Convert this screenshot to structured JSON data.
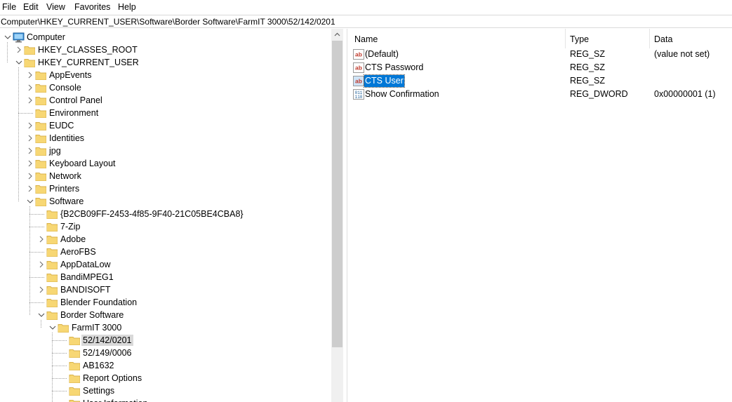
{
  "menu": [
    "File",
    "Edit",
    "View",
    "Favorites",
    "Help"
  ],
  "address": "Computer\\HKEY_CURRENT_USER\\Software\\Border Software\\FarmIT 3000\\52/142/0201",
  "colors": {
    "folder": "#f7d774",
    "folder_edge": "#d9b24a",
    "selection": "#0078d7",
    "tree_selection": "#d9d9d9"
  },
  "tree": [
    {
      "label": "Computer",
      "level": 0,
      "state": "expanded",
      "icon": "computer-icon"
    },
    {
      "label": "HKEY_CLASSES_ROOT",
      "level": 1,
      "state": "collapsed"
    },
    {
      "label": "HKEY_CURRENT_USER",
      "level": 1,
      "state": "expanded"
    },
    {
      "label": "AppEvents",
      "level": 2,
      "state": "collapsed"
    },
    {
      "label": "Console",
      "level": 2,
      "state": "collapsed"
    },
    {
      "label": "Control Panel",
      "level": 2,
      "state": "collapsed"
    },
    {
      "label": "Environment",
      "level": 2,
      "state": "leaf"
    },
    {
      "label": "EUDC",
      "level": 2,
      "state": "collapsed"
    },
    {
      "label": "Identities",
      "level": 2,
      "state": "collapsed"
    },
    {
      "label": "jpg",
      "level": 2,
      "state": "collapsed"
    },
    {
      "label": "Keyboard Layout",
      "level": 2,
      "state": "collapsed"
    },
    {
      "label": "Network",
      "level": 2,
      "state": "collapsed"
    },
    {
      "label": "Printers",
      "level": 2,
      "state": "collapsed"
    },
    {
      "label": "Software",
      "level": 2,
      "state": "expanded"
    },
    {
      "label": "{B2CB09FF-2453-4f85-9F40-21C05BE4CBA8}",
      "level": 3,
      "state": "leaf"
    },
    {
      "label": "7-Zip",
      "level": 3,
      "state": "leaf"
    },
    {
      "label": "Adobe",
      "level": 3,
      "state": "collapsed"
    },
    {
      "label": "AeroFBS",
      "level": 3,
      "state": "leaf"
    },
    {
      "label": "AppDataLow",
      "level": 3,
      "state": "collapsed"
    },
    {
      "label": "BandiMPEG1",
      "level": 3,
      "state": "leaf"
    },
    {
      "label": "BANDISOFT",
      "level": 3,
      "state": "collapsed"
    },
    {
      "label": "Blender Foundation",
      "level": 3,
      "state": "leaf"
    },
    {
      "label": "Border Software",
      "level": 3,
      "state": "expanded"
    },
    {
      "label": "FarmIT 3000",
      "level": 4,
      "state": "expanded"
    },
    {
      "label": "52/142/0201",
      "level": 5,
      "state": "leaf",
      "selected": true
    },
    {
      "label": "52/149/0006",
      "level": 5,
      "state": "leaf"
    },
    {
      "label": "AB1632",
      "level": 5,
      "state": "leaf"
    },
    {
      "label": "Report Options",
      "level": 5,
      "state": "leaf"
    },
    {
      "label": "Settings",
      "level": 5,
      "state": "leaf"
    },
    {
      "label": "User Information",
      "level": 5,
      "state": "leaf"
    }
  ],
  "columns": {
    "name": "Name",
    "type": "Type",
    "data": "Data"
  },
  "values": [
    {
      "name": "(Default)",
      "type": "REG_SZ",
      "data": "(value not set)",
      "icon": "string-value-icon"
    },
    {
      "name": "CTS Password",
      "type": "REG_SZ",
      "data": "",
      "icon": "string-value-icon"
    },
    {
      "name": "CTS User",
      "type": "REG_SZ",
      "data": "",
      "icon": "string-value-icon",
      "selected": true
    },
    {
      "name": "Show Confirmation",
      "type": "REG_DWORD",
      "data": "0x00000001 (1)",
      "icon": "binary-value-icon"
    }
  ]
}
